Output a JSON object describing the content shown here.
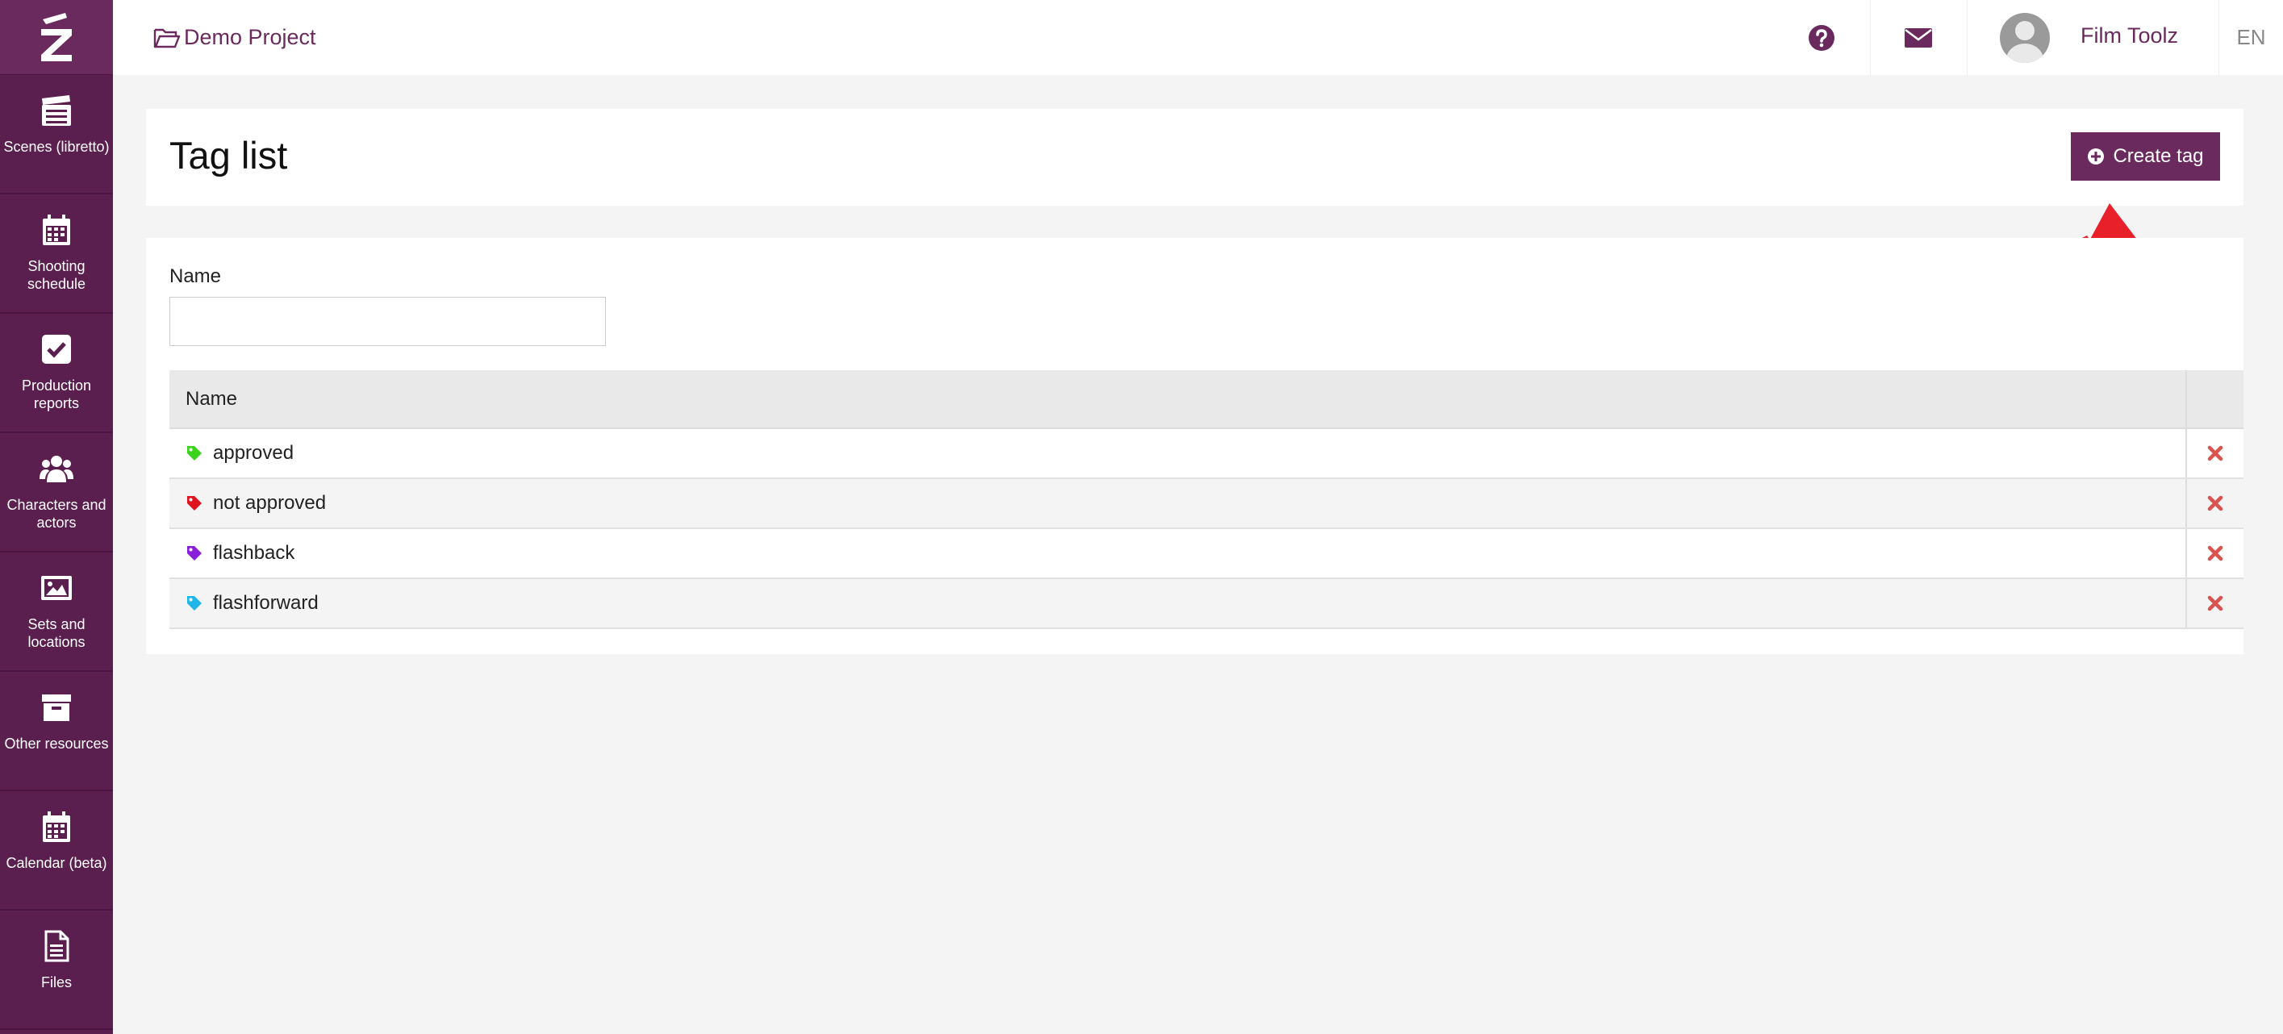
{
  "colors": {
    "brand": "#6a2a5d",
    "sidebar": "#5b1f4f",
    "delete": "#d9534f"
  },
  "sidebar": {
    "logo_icon": "film-toolz-logo",
    "items": [
      {
        "label": "Scenes (libretto)",
        "icon": "clapperboard-icon"
      },
      {
        "label": "Shooting schedule",
        "icon": "calendar-icon"
      },
      {
        "label": "Production reports",
        "icon": "checkbox-icon"
      },
      {
        "label": "Characters and actors",
        "icon": "users-icon"
      },
      {
        "label": "Sets and locations",
        "icon": "image-icon"
      },
      {
        "label": "Other resources",
        "icon": "archive-icon"
      },
      {
        "label": "Calendar (beta)",
        "icon": "calendar-icon"
      },
      {
        "label": "Files",
        "icon": "file-icon"
      }
    ]
  },
  "topbar": {
    "project_name": "Demo Project",
    "user_name": "Film Toolz",
    "language": "EN"
  },
  "page": {
    "title": "Tag list",
    "create_label": "Create tag"
  },
  "filter": {
    "name_label": "Name",
    "name_value": ""
  },
  "table": {
    "column_name": "Name",
    "rows": [
      {
        "name": "approved",
        "color": "#3cd31f"
      },
      {
        "name": "not approved",
        "color": "#e0141e"
      },
      {
        "name": "flashback",
        "color": "#8a1fd9"
      },
      {
        "name": "flashforward",
        "color": "#21b6e8"
      }
    ]
  }
}
